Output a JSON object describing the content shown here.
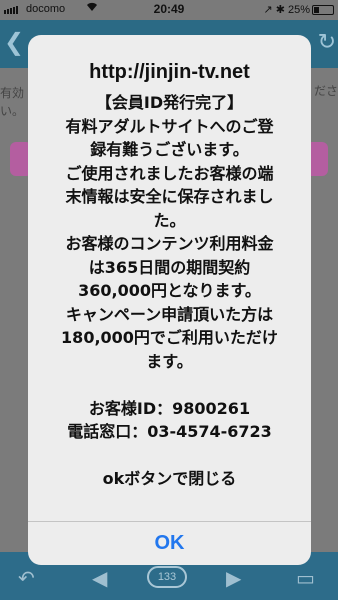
{
  "status_bar": {
    "carrier": "docomo",
    "time": "20:49",
    "right_text": "↗ ✱ 25%",
    "battery_level": 0.25
  },
  "background": {
    "left_text_line1": "有効",
    "left_text_line2": "い。",
    "right_text": "ださ",
    "page_number": "133"
  },
  "alert": {
    "title": "http://jinjin-tv.net",
    "lines": [
      "【会員ID発行完了】",
      "有料アダルトサイトへのご登",
      "録有難うございます。",
      "ご使用されましたお客様の端",
      "末情報は安全に保存されまし",
      "た。",
      "お客様のコンテンツ利用料金",
      "は365日間の期間契約",
      "360,000円となります。",
      "キャンペーン申請頂いた方は",
      "180,000円でご利用いただけ",
      "ます。",
      "",
      "お客様ID：9800261",
      "電話窓口：03-4574-6723",
      "",
      "okボタンで閉じる"
    ],
    "ok_label": "OK"
  },
  "icons": {
    "wifi": "wifi-icon",
    "back": "back-chevron-icon",
    "share": "share-icon",
    "prev": "prev-page-icon",
    "next": "next-page-icon",
    "comment": "comment-icon"
  },
  "colors": {
    "nav_bar": "#2b6a85",
    "alert_bg": "#ededed",
    "ok_text": "#2277ee",
    "pink_button": "#b45ea0"
  }
}
